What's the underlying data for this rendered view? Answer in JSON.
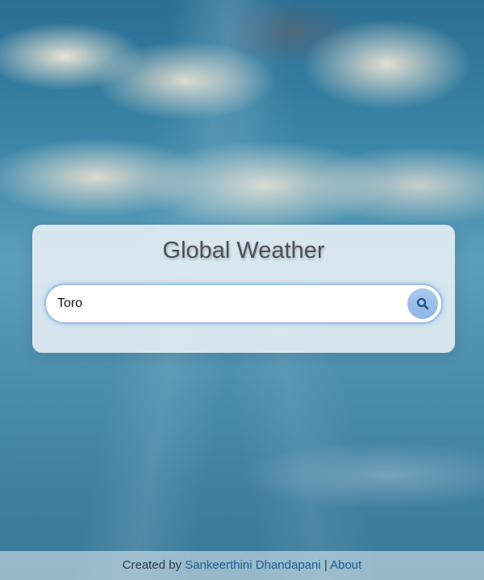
{
  "app": {
    "title": "Global Weather"
  },
  "search": {
    "value": "Toro",
    "button_icon": "search-icon"
  },
  "footer": {
    "created_by_prefix": "Created by",
    "author_link": "Sankeerthini Dhandapani",
    "separator": "|",
    "about_link": "About"
  },
  "colors": {
    "title_text": "#4d5054",
    "search_border": "#9cc0ea",
    "search_button": "#8eb6e6",
    "link": "#1c5d92"
  }
}
